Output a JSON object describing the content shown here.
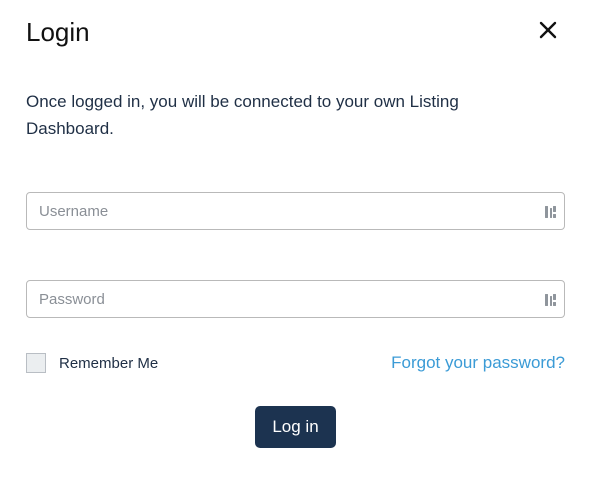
{
  "dialog": {
    "title": "Login",
    "intro": "Once logged in, you will be connected to your own Listing Dashboard."
  },
  "username": {
    "placeholder": "Username",
    "value": "",
    "icon": "password-manager-icon"
  },
  "password": {
    "placeholder": "Password",
    "value": "",
    "icon": "password-manager-icon"
  },
  "remember": {
    "label": "Remember Me",
    "checked": false
  },
  "forgot": {
    "label": "Forgot your password?"
  },
  "submit": {
    "label": "Log in"
  },
  "colors": {
    "primary": "#1c3350",
    "link": "#3b9bd6",
    "text": "#1f2f45"
  }
}
